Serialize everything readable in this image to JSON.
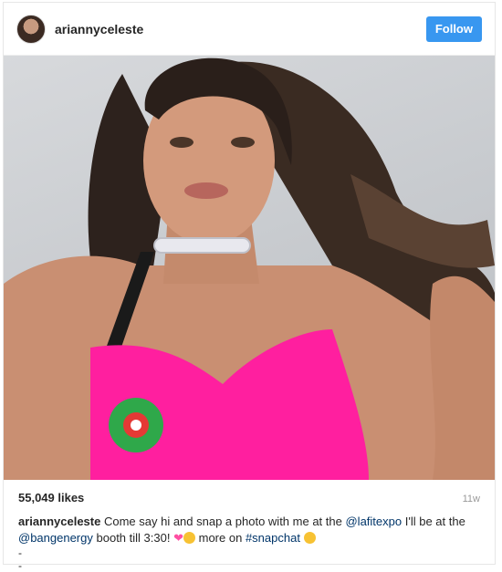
{
  "post": {
    "username": "ariannyceleste",
    "follow_label": "Follow",
    "likes": "55,049 likes",
    "time_ago": "11w",
    "caption": {
      "username": "ariannyceleste",
      "text_1": "Come say hi and snap a photo with me at the",
      "mention_1": "@lafitexpo",
      "text_2": "I'll be at the",
      "mention_2": "@bangenergy",
      "text_3": "booth till 3:30!",
      "text_4": "more on",
      "hashtag": "#snapchat"
    },
    "extra_lines": [
      "-",
      "-"
    ]
  },
  "colors": {
    "follow_button": "#3897f0",
    "link": "#003569",
    "top_pink": "#ff1f9f"
  },
  "icons": [
    "heart-icon",
    "wink-emoji-icon",
    "kiss-emoji-icon"
  ]
}
